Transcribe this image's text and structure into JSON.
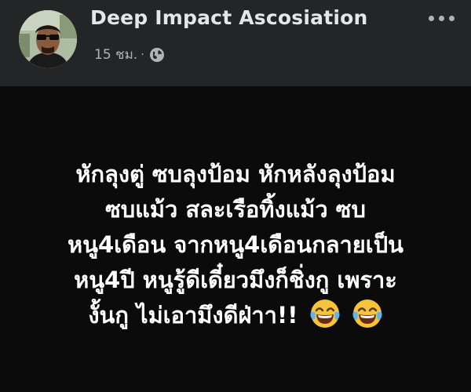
{
  "post": {
    "author_name": "Deep Impact Ascosiation",
    "timestamp": "15 ชม.",
    "separator": "·",
    "privacy_icon": "globe-icon",
    "more_icon": "more-options-icon",
    "text_lines": [
      "หักลุงตู่ ซบลุงป้อม หักหลังลุงป้อม",
      "ซบแม้ว สละเรือทิ้งแม้ว ซบ",
      "หนู4เดือน จากหนู4เดือนกลายเป็น",
      "หนู4ปี หนูรู้ดีเดี๋ยวมึงก็ชิ่งกู เพราะ",
      "งั้นกู ไม่เอามึงดีฝ่าา!!"
    ],
    "emojis": [
      "tears-of-joy-emoji",
      "tears-of-joy-emoji"
    ]
  },
  "colors": {
    "header_bg": "#242526",
    "post_bg": "#0b0b0b",
    "author_text": "#e4e6eb",
    "meta_text": "#b0b3b8",
    "body_text": "#ffffff"
  }
}
